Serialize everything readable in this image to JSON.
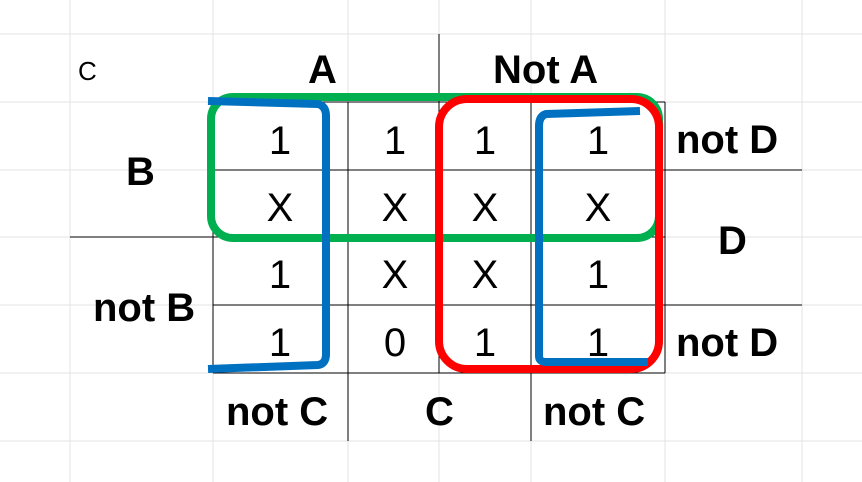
{
  "corner_label": "C",
  "column_headers": {
    "a": "A",
    "not_a": "Not A"
  },
  "bottom_headers": {
    "not_c_left": "not C",
    "c": "C",
    "not_c_right": "not C"
  },
  "row_headers": {
    "b": "B",
    "not_b": "not B"
  },
  "right_headers": {
    "not_d_top": "not D",
    "d": "D",
    "not_d_bottom": "not D"
  },
  "grid": [
    [
      "1",
      "1",
      "1",
      "1"
    ],
    [
      "X",
      "X",
      "X",
      "X"
    ],
    [
      "1",
      "X",
      "X",
      "1"
    ],
    [
      "1",
      "0",
      "1",
      "1"
    ]
  ],
  "groups": [
    {
      "name": "green",
      "color": "#00b050"
    },
    {
      "name": "red",
      "color": "#ff0000"
    },
    {
      "name": "blue",
      "color": "#0070c0"
    }
  ]
}
